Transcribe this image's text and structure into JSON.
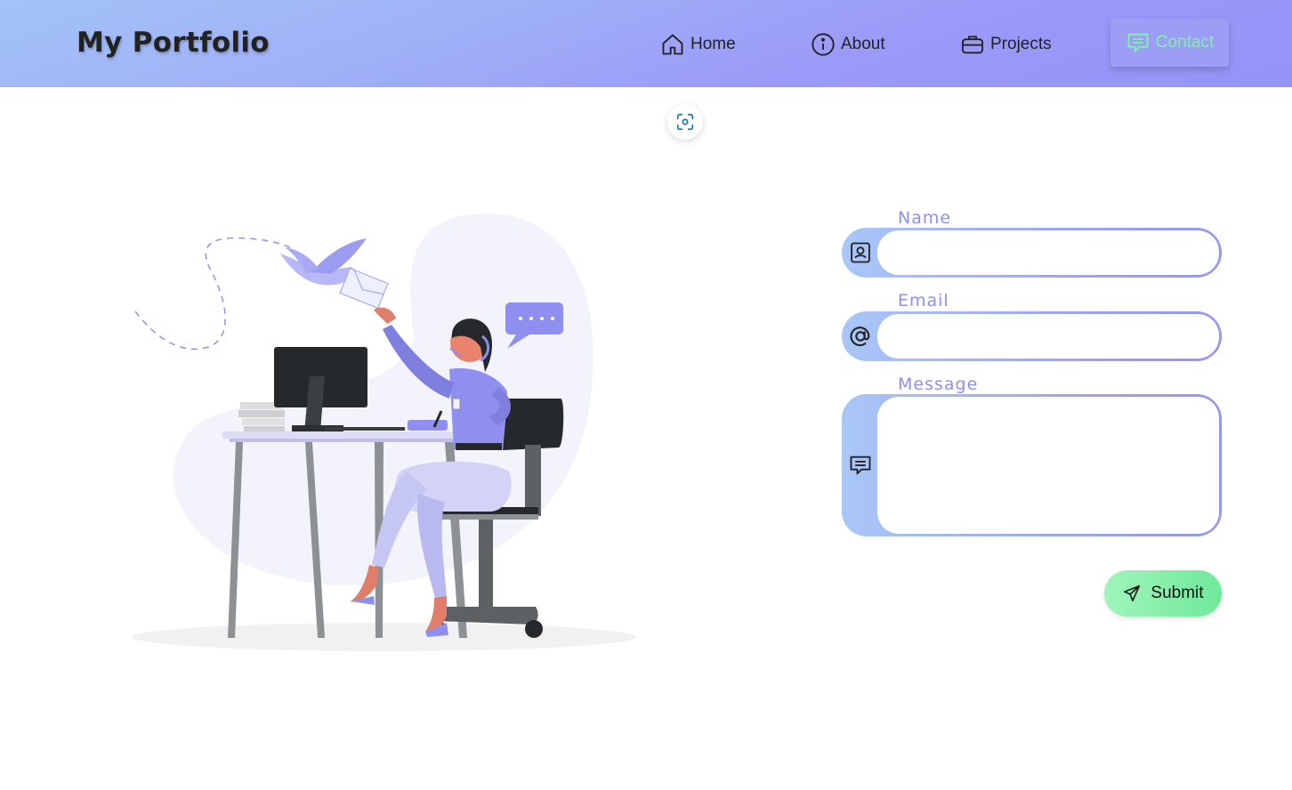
{
  "header": {
    "brand": "My Portfolio",
    "nav": [
      {
        "label": "Home",
        "icon": "home-icon"
      },
      {
        "label": "About",
        "icon": "info-icon"
      },
      {
        "label": "Projects",
        "icon": "briefcase-icon"
      },
      {
        "label": "Contact",
        "icon": "message-icon",
        "active": true
      }
    ]
  },
  "form": {
    "name_label": "Name",
    "name_value": "",
    "email_label": "Email",
    "email_value": "",
    "message_label": "Message",
    "message_value": "",
    "submit_label": "Submit"
  },
  "colors": {
    "header_gradient_start": "#a4c3f7",
    "header_gradient_end": "#9394f7",
    "label_color": "#8e8ff2",
    "active_nav_text": "#7ef2a6",
    "submit_gradient_start": "#a0f5bb",
    "submit_gradient_end": "#6ee99a"
  }
}
